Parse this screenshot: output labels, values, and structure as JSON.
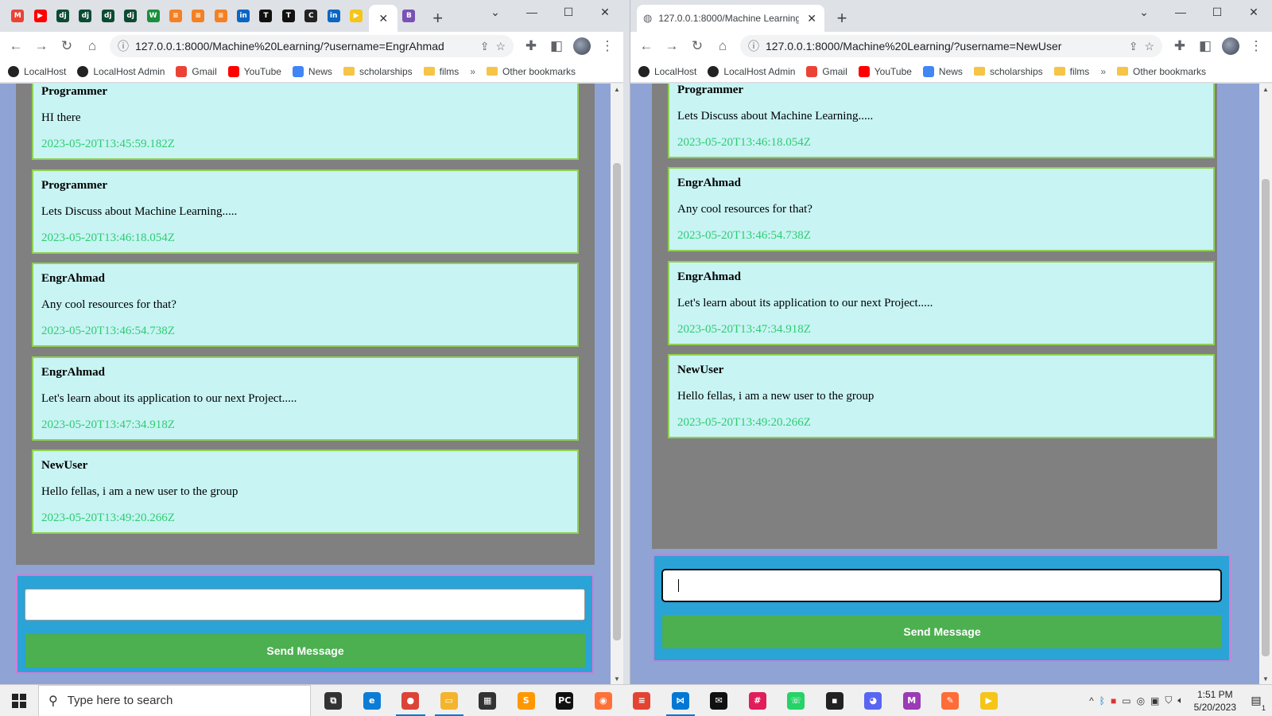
{
  "left_window": {
    "tab_title": "",
    "url": "127.0.0.1:8000/Machine%20Learning/?username=EngrAhmad",
    "pinned_tabs": [
      {
        "icon": "gmail-icon",
        "label": "M",
        "color": "#ea4335"
      },
      {
        "icon": "youtube-icon",
        "label": "▶",
        "color": "#ff0000"
      },
      {
        "icon": "django-icon",
        "label": "dj",
        "color": "#0c4b33"
      },
      {
        "icon": "django-icon",
        "label": "dj",
        "color": "#0c4b33"
      },
      {
        "icon": "django-icon",
        "label": "dj",
        "color": "#0c4b33"
      },
      {
        "icon": "django-icon",
        "label": "dj",
        "color": "#0c4b33"
      },
      {
        "icon": "w-icon",
        "label": "W",
        "color": "#1a8f3c"
      },
      {
        "icon": "stackoverflow-icon",
        "label": "≡",
        "color": "#f48024"
      },
      {
        "icon": "stackoverflow-icon",
        "label": "≡",
        "color": "#f48024"
      },
      {
        "icon": "stackoverflow-icon",
        "label": "≡",
        "color": "#f48024"
      },
      {
        "icon": "linkedin-icon",
        "label": "in",
        "color": "#0a66c2"
      },
      {
        "icon": "t-icon",
        "label": "T",
        "color": "#111111"
      },
      {
        "icon": "t-icon",
        "label": "T",
        "color": "#111111"
      },
      {
        "icon": "c-icon",
        "label": "C",
        "color": "#222222"
      },
      {
        "icon": "linkedin-icon",
        "label": "in",
        "color": "#0a66c2"
      },
      {
        "icon": "youtube-icon",
        "label": "▶",
        "color": "#f5c518"
      }
    ],
    "bootstrap_tab_icon": "B"
  },
  "right_window": {
    "tab_title": "127.0.0.1:8000/Machine Learning",
    "url": "127.0.0.1:8000/Machine%20Learning/?username=NewUser"
  },
  "bookmarks": [
    {
      "label": "LocalHost",
      "icon": "github-icon"
    },
    {
      "label": "LocalHost Admin",
      "icon": "github-icon"
    },
    {
      "label": "Gmail",
      "icon": "gmail-icon"
    },
    {
      "label": "YouTube",
      "icon": "youtube-icon"
    },
    {
      "label": "News",
      "icon": "news-icon"
    },
    {
      "label": "scholarships",
      "icon": "folder-icon"
    },
    {
      "label": "films",
      "icon": "folder-icon"
    }
  ],
  "bookmarks_more": "»",
  "other_bookmarks": "Other bookmarks",
  "messages": [
    {
      "user": "Programmer",
      "text": "HI there",
      "time": "2023-05-20T13:45:59.182Z"
    },
    {
      "user": "Programmer",
      "text": "Lets Discuss about Machine Learning.....",
      "time": "2023-05-20T13:46:18.054Z"
    },
    {
      "user": "EngrAhmad",
      "text": "Any cool resources for that?",
      "time": "2023-05-20T13:46:54.738Z"
    },
    {
      "user": "EngrAhmad",
      "text": "Let's learn about its application to our next Project.....",
      "time": "2023-05-20T13:47:34.918Z"
    },
    {
      "user": "NewUser",
      "text": "Hello fellas, i am a new user to the group",
      "time": "2023-05-20T13:49:20.266Z"
    }
  ],
  "send_label": "Send Message",
  "input_value": "",
  "taskbar": {
    "search_placeholder": "Type here to search",
    "time": "1:51 PM",
    "date": "5/20/2023",
    "notification_count": "1",
    "apps": [
      {
        "icon": "task-view-icon",
        "label": "⧉",
        "color": "#333333",
        "active": false
      },
      {
        "icon": "edge-icon",
        "label": "e",
        "color": "#0c7dd6",
        "active": false
      },
      {
        "icon": "chrome-icon",
        "label": "●",
        "color": "#db4437",
        "active": true
      },
      {
        "icon": "file-explorer-icon",
        "label": "▭",
        "color": "#f3b42e",
        "active": true
      },
      {
        "icon": "store-icon",
        "label": "▦",
        "color": "#333333",
        "active": false
      },
      {
        "icon": "sublime-icon",
        "label": "S",
        "color": "#ff9800",
        "active": false
      },
      {
        "icon": "pycharm-icon",
        "label": "PC",
        "color": "#111111",
        "active": false
      },
      {
        "icon": "firefox-icon",
        "label": "◉",
        "color": "#ff7139",
        "active": false
      },
      {
        "icon": "todoist-icon",
        "label": "≡",
        "color": "#e44332",
        "active": false
      },
      {
        "icon": "vscode-icon",
        "label": "⋈",
        "color": "#0078d4",
        "active": true
      },
      {
        "icon": "mail-icon",
        "label": "✉",
        "color": "#111111",
        "active": false
      },
      {
        "icon": "slack-icon",
        "label": "#",
        "color": "#e01e5a",
        "active": false
      },
      {
        "icon": "whatsapp-icon",
        "label": "☏",
        "color": "#25d366",
        "active": false
      },
      {
        "icon": "sticky-icon",
        "label": "▪",
        "color": "#222222",
        "active": false
      },
      {
        "icon": "discord-icon",
        "label": "◕",
        "color": "#5865f2",
        "active": false
      },
      {
        "icon": "m-app-icon",
        "label": "M",
        "color": "#9b3bb5",
        "active": false
      },
      {
        "icon": "postman-icon",
        "label": "✎",
        "color": "#ff6c37",
        "active": false
      },
      {
        "icon": "stickies-icon",
        "label": "▶",
        "color": "#f5c518",
        "active": false
      }
    ]
  }
}
